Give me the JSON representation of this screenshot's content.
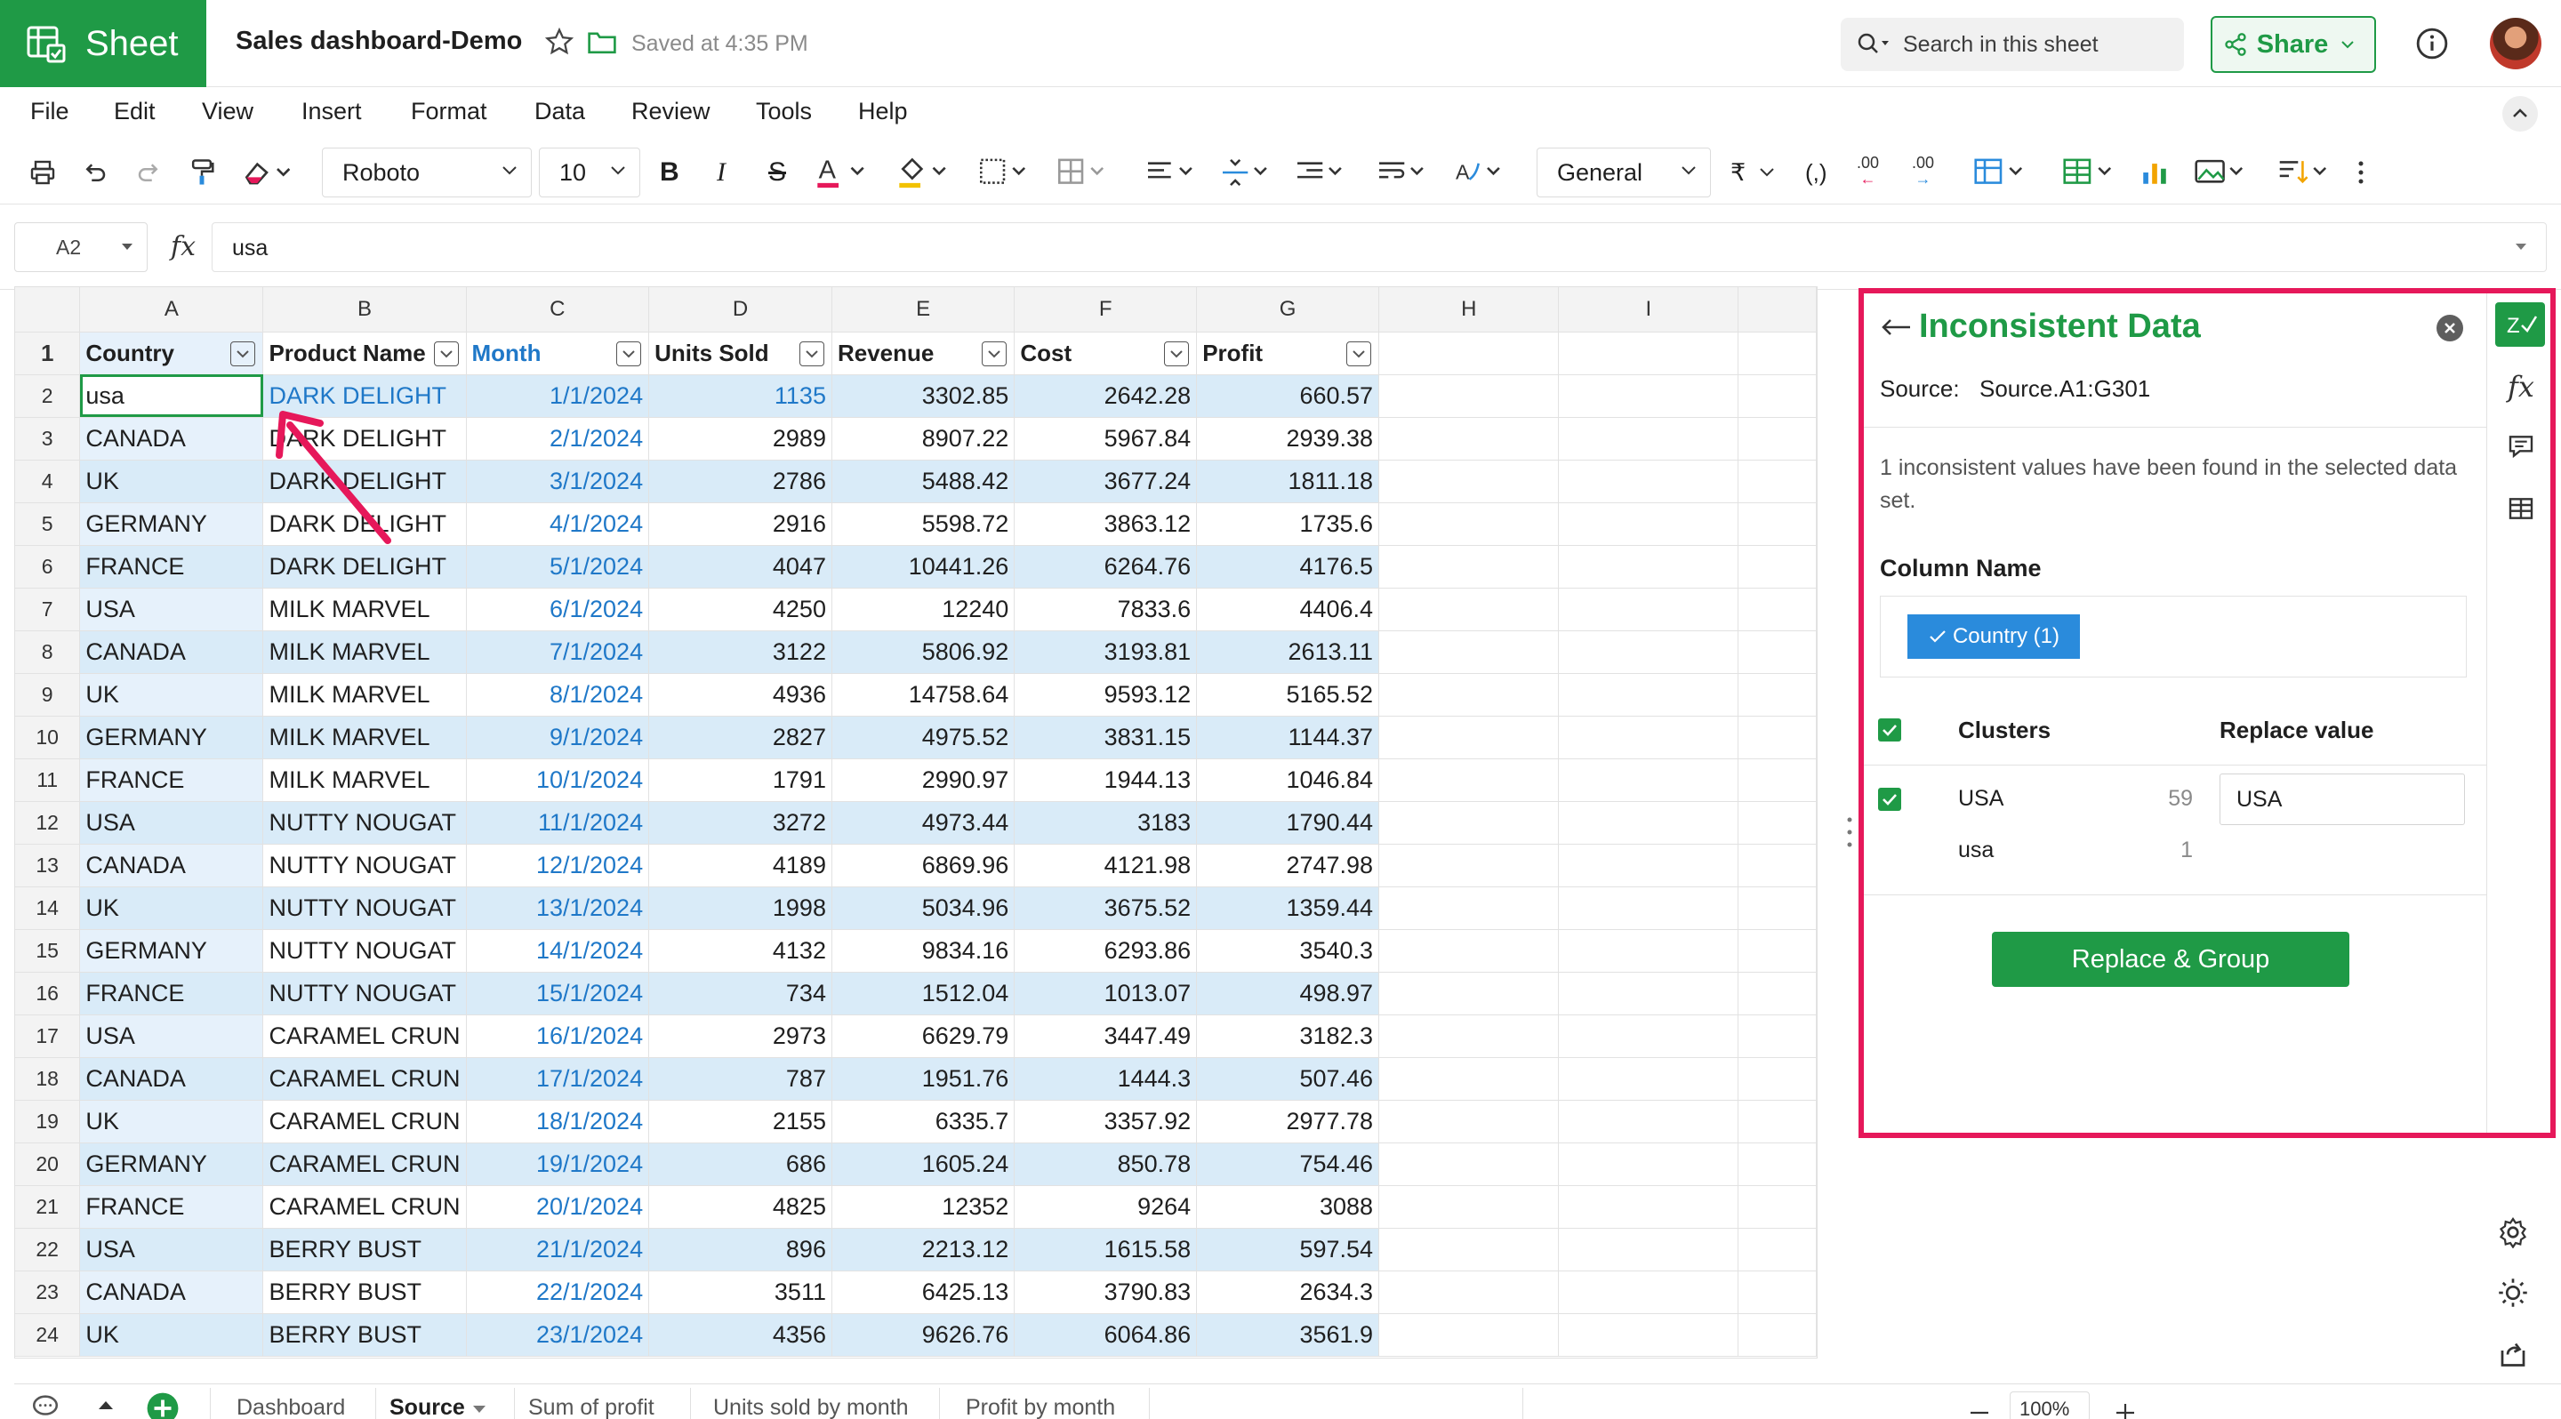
{
  "app": {
    "name": "Sheet",
    "brand_color": "#1f9a46"
  },
  "document": {
    "title": "Sales dashboard-Demo",
    "saved_status": "Saved at 4:35 PM"
  },
  "search": {
    "placeholder": "Search in this sheet"
  },
  "share": {
    "label": "Share"
  },
  "menu": [
    "File",
    "Edit",
    "View",
    "Insert",
    "Format",
    "Data",
    "Review",
    "Tools",
    "Help"
  ],
  "toolbar": {
    "font_family": "Roboto",
    "font_size": "10",
    "number_format": "General",
    "currency_symbol": "₹",
    "decrease_decimal": ".00",
    "increase_decimal": ".00"
  },
  "formula_bar": {
    "cell_ref": "A2",
    "fx": "fx",
    "value": "usa"
  },
  "grid": {
    "column_letters": [
      "A",
      "B",
      "C",
      "D",
      "E",
      "F",
      "G",
      "H",
      "I"
    ],
    "headers": [
      "Country",
      "Product Name",
      "Month",
      "Units Sold",
      "Revenue",
      "Cost",
      "Profit"
    ],
    "rows": [
      [
        "usa",
        "DARK DELIGHT",
        "1/1/2024",
        "1135",
        "3302.85",
        "2642.28",
        "660.57"
      ],
      [
        "CANADA",
        "DARK DELIGHT",
        "2/1/2024",
        "2989",
        "8907.22",
        "5967.84",
        "2939.38"
      ],
      [
        "UK",
        "DARK DELIGHT",
        "3/1/2024",
        "2786",
        "5488.42",
        "3677.24",
        "1811.18"
      ],
      [
        "GERMANY",
        "DARK DELIGHT",
        "4/1/2024",
        "2916",
        "5598.72",
        "3863.12",
        "1735.6"
      ],
      [
        "FRANCE",
        "DARK DELIGHT",
        "5/1/2024",
        "4047",
        "10441.26",
        "6264.76",
        "4176.5"
      ],
      [
        "USA",
        "MILK MARVEL",
        "6/1/2024",
        "4250",
        "12240",
        "7833.6",
        "4406.4"
      ],
      [
        "CANADA",
        "MILK MARVEL",
        "7/1/2024",
        "3122",
        "5806.92",
        "3193.81",
        "2613.11"
      ],
      [
        "UK",
        "MILK MARVEL",
        "8/1/2024",
        "4936",
        "14758.64",
        "9593.12",
        "5165.52"
      ],
      [
        "GERMANY",
        "MILK MARVEL",
        "9/1/2024",
        "2827",
        "4975.52",
        "3831.15",
        "1144.37"
      ],
      [
        "FRANCE",
        "MILK MARVEL",
        "10/1/2024",
        "1791",
        "2990.97",
        "1944.13",
        "1046.84"
      ],
      [
        "USA",
        "NUTTY NOUGAT",
        "11/1/2024",
        "3272",
        "4973.44",
        "3183",
        "1790.44"
      ],
      [
        "CANADA",
        "NUTTY NOUGAT",
        "12/1/2024",
        "4189",
        "6869.96",
        "4121.98",
        "2747.98"
      ],
      [
        "UK",
        "NUTTY NOUGAT",
        "13/1/2024",
        "1998",
        "5034.96",
        "3675.52",
        "1359.44"
      ],
      [
        "GERMANY",
        "NUTTY NOUGAT",
        "14/1/2024",
        "4132",
        "9834.16",
        "6293.86",
        "3540.3"
      ],
      [
        "FRANCE",
        "NUTTY NOUGAT",
        "15/1/2024",
        "734",
        "1512.04",
        "1013.07",
        "498.97"
      ],
      [
        "USA",
        "CARAMEL CRUN",
        "16/1/2024",
        "2973",
        "6629.79",
        "3447.49",
        "3182.3"
      ],
      [
        "CANADA",
        "CARAMEL CRUN",
        "17/1/2024",
        "787",
        "1951.76",
        "1444.3",
        "507.46"
      ],
      [
        "UK",
        "CARAMEL CRUN",
        "18/1/2024",
        "2155",
        "6335.7",
        "3357.92",
        "2977.78"
      ],
      [
        "GERMANY",
        "CARAMEL CRUN",
        "19/1/2024",
        "686",
        "1605.24",
        "850.78",
        "754.46"
      ],
      [
        "FRANCE",
        "CARAMEL CRUN",
        "20/1/2024",
        "4825",
        "12352",
        "9264",
        "3088"
      ],
      [
        "USA",
        "BERRY BUST",
        "21/1/2024",
        "896",
        "2213.12",
        "1615.58",
        "597.54"
      ],
      [
        "CANADA",
        "BERRY BUST",
        "22/1/2024",
        "3511",
        "6425.13",
        "3790.83",
        "2634.3"
      ],
      [
        "UK",
        "BERRY BUST",
        "23/1/2024",
        "4356",
        "9626.76",
        "6064.86",
        "3561.9"
      ]
    ]
  },
  "panel": {
    "title": "Inconsistent Data",
    "source_label": "Source:",
    "source_value": "Source.A1:G301",
    "message": "1 inconsistent values have been found in the selected data set.",
    "column_heading": "Column Name",
    "column_chip": "Country (1)",
    "clusters_heading": "Clusters",
    "replace_heading": "Replace value",
    "cluster_main": {
      "value": "USA",
      "count": "59"
    },
    "cluster_sub": {
      "value": "usa",
      "count": "1"
    },
    "replace_input": "USA",
    "button": "Replace & Group",
    "highlight_color": "#e6185a",
    "rail_fx": "fx"
  },
  "sheet_tabs": [
    "Dashboard",
    "Source",
    "Sum of profit",
    "Units sold by month",
    "Profit by month"
  ],
  "zoom": "100%"
}
